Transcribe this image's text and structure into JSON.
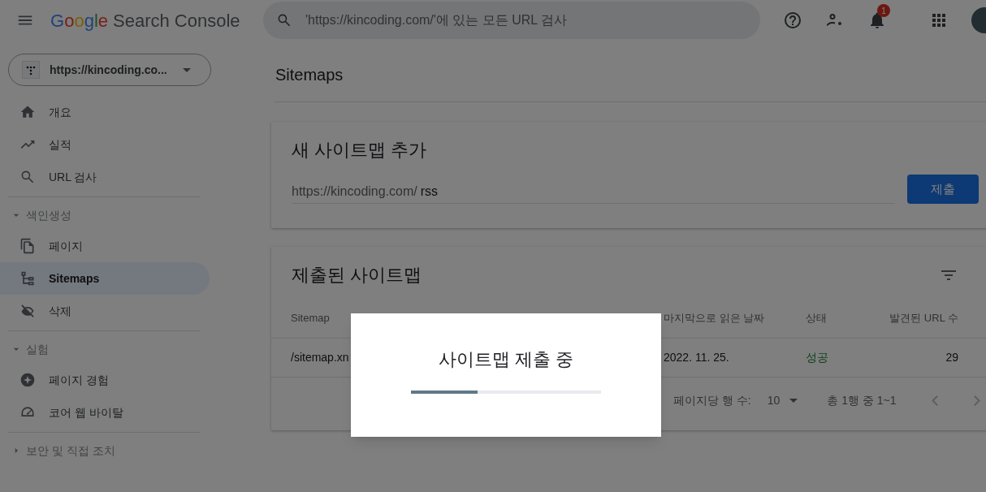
{
  "header": {
    "logo": "Google",
    "product": "Search Console",
    "search": {
      "placeholder": "'https://kincoding.com/'에 있는 모든 URL 검사"
    },
    "notifications": "1"
  },
  "property": {
    "label": "https://kincoding.co..."
  },
  "sidebar": {
    "items": [
      {
        "label": "개요",
        "selected": false
      },
      {
        "label": "실적",
        "selected": false
      },
      {
        "label": "URL 검사",
        "selected": false
      }
    ],
    "sections": [
      {
        "label": "색인생성",
        "expanded": true,
        "items": [
          {
            "label": "페이지",
            "selected": false
          },
          {
            "label": "Sitemaps",
            "selected": true
          },
          {
            "label": "삭제",
            "selected": false
          }
        ]
      },
      {
        "label": "실험",
        "expanded": true,
        "items": [
          {
            "label": "페이지 경험",
            "selected": false
          },
          {
            "label": "코어 웹 바이탈",
            "selected": false
          }
        ]
      },
      {
        "label": "보안 및 직접 조치",
        "expanded": false
      }
    ]
  },
  "page_title": "Sitemaps",
  "add_card": {
    "title": "새 사이트맵 추가",
    "prefix": "https://kincoding.com/",
    "value": "rss",
    "button": "제출"
  },
  "submitted_card": {
    "title": "제출된 사이트맵",
    "columns": [
      "Sitemap",
      "",
      "",
      "마지막으로 읽은 날짜",
      "상태",
      "발견된 URL 수"
    ],
    "rows": [
      {
        "cells": [
          "/sitemap.xn",
          "",
          "",
          "2022. 11. 25.",
          "성공",
          "29"
        ]
      }
    ],
    "rows_per_page_label": "페이지당 행 수:",
    "rows_per_page": "10",
    "range": "총 1행 중 1~1"
  },
  "dialog": {
    "title": "사이트맵 제출 중",
    "progress": {
      "level": 0.35
    }
  }
}
